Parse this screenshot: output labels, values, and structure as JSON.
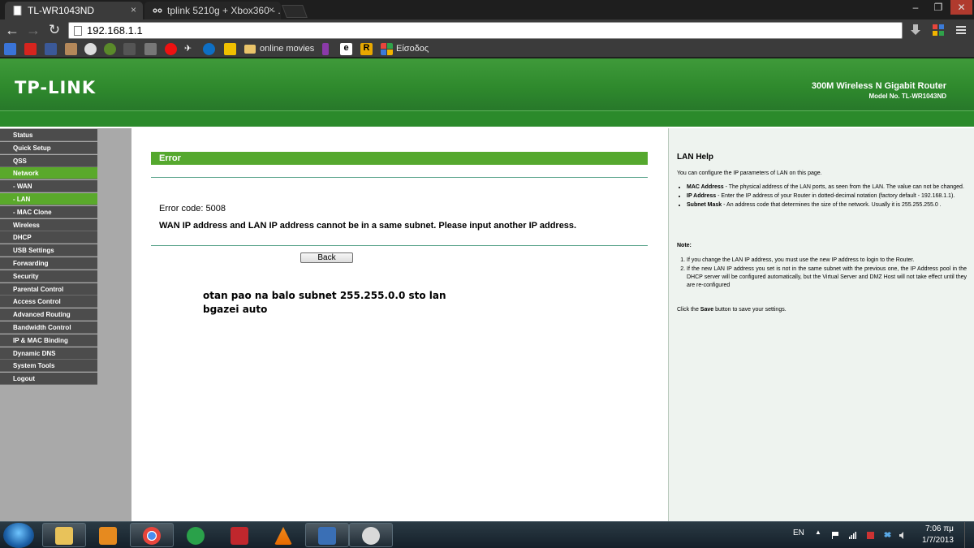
{
  "browser": {
    "tabs": [
      {
        "title": "TL-WR1043ND",
        "active": true
      },
      {
        "title": "tplink 5210g + Xbox360 - ...",
        "active": false
      }
    ],
    "address": "192.168.1.1",
    "bookmarks": {
      "folder_label": "online movies",
      "greek_label": "Είσοδος"
    }
  },
  "router": {
    "logo": "TP-LINK",
    "product_name": "300M Wireless N Gigabit Router",
    "model_no": "Model No. TL-WR1043ND",
    "menu": [
      {
        "label": "Status",
        "state": "normal"
      },
      {
        "label": "Quick Setup",
        "state": "normal"
      },
      {
        "label": "QSS",
        "state": "normal"
      },
      {
        "label": "Network",
        "state": "active"
      },
      {
        "label": "- WAN",
        "state": "sub"
      },
      {
        "label": "- LAN",
        "state": "sub-active"
      },
      {
        "label": "- MAC Clone",
        "state": "sub"
      },
      {
        "label": "Wireless",
        "state": "normal"
      },
      {
        "label": "DHCP",
        "state": "normal"
      },
      {
        "label": "USB Settings",
        "state": "normal"
      },
      {
        "label": "Forwarding",
        "state": "normal"
      },
      {
        "label": "Security",
        "state": "normal"
      },
      {
        "label": "Parental Control",
        "state": "normal"
      },
      {
        "label": "Access Control",
        "state": "normal"
      },
      {
        "label": "Advanced Routing",
        "state": "normal"
      },
      {
        "label": "Bandwidth Control",
        "state": "normal"
      },
      {
        "label": "IP & MAC Binding",
        "state": "normal"
      },
      {
        "label": "Dynamic DNS",
        "state": "normal"
      },
      {
        "label": "System Tools",
        "state": "normal"
      },
      {
        "label": "Logout",
        "state": "normal"
      }
    ],
    "error": {
      "title": "Error",
      "code": "Error code: 5008",
      "message": "WAN IP address and LAN IP address cannot be in a same subnet. Please input another IP address.",
      "back_label": "Back"
    },
    "annotation": {
      "line1": "otan pao na balo subnet 255.255.0.0 sto lan",
      "line2": "bgazei auto"
    },
    "help": {
      "title": "LAN Help",
      "intro": "You can configure the IP parameters of LAN on this page.",
      "items": [
        {
          "term": "MAC Address",
          "text": " - The physical address of the LAN ports, as seen from the LAN. The value can not be changed."
        },
        {
          "term": "IP Address",
          "text": " - Enter the IP address of your Router in dotted-decimal notation (factory default - 192.168.1.1)."
        },
        {
          "term": "Subnet Mask",
          "text": " - An address code that determines the size of the network. Usually it is 255.255.255.0 ."
        }
      ],
      "note_label": "Note:",
      "notes": [
        "If you change the LAN IP address, you must use the new IP address to login to the Router.",
        "If the new LAN IP address you set is not in the same subnet with the previous one, the IP Address pool in the DHCP server will be configured automatically, but the Virtual Server and DMZ Host will not take effect until they are re-configured"
      ],
      "footer_prefix": "Click the ",
      "footer_bold": "Save",
      "footer_suffix": " button to save your settings."
    }
  },
  "taskbar": {
    "language": "EN",
    "time": "7:06 πμ",
    "date": "1/7/2013"
  },
  "colors": {
    "brand_green": "#2f8a2d",
    "menu_active": "#5aa92b",
    "menu_bg": "#4c4c4c"
  }
}
